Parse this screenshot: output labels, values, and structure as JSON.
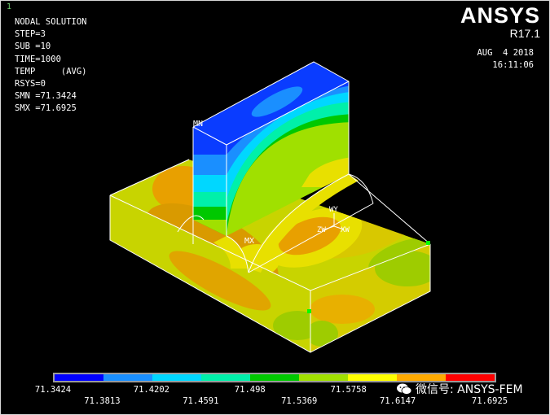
{
  "window_number": "1",
  "info": {
    "line1": "NODAL SOLUTION",
    "step": "STEP=3",
    "sub": "SUB =10",
    "time": "TIME=1000",
    "temp": "TEMP     (AVG)",
    "rsys": "RSYS=0",
    "smn": "SMN =71.3424",
    "smx": "SMX =71.6925"
  },
  "brand": {
    "logo": "ANSYS",
    "version": "R17.1"
  },
  "stamp": {
    "date": "AUG  4 2018",
    "time": "16:11:06"
  },
  "labels": {
    "mn": "MN",
    "mx": "MX",
    "wy": "WY",
    "zw": "ZW",
    "xw": "XW"
  },
  "legend": {
    "colors": [
      "#0000ff",
      "#1a8fff",
      "#00d7ff",
      "#00f0aa",
      "#00c800",
      "#a0e000",
      "#ffff00",
      "#ffaa00",
      "#ff0000"
    ],
    "ticks_top": [
      "71.3424",
      "71.4202",
      "71.498",
      "71.5758"
    ],
    "ticks_bottom": [
      "71.3813",
      "71.4591",
      "71.5369",
      "71.6147",
      "71.6925"
    ]
  },
  "watermark": "微信号: ANSYS-FEM"
}
